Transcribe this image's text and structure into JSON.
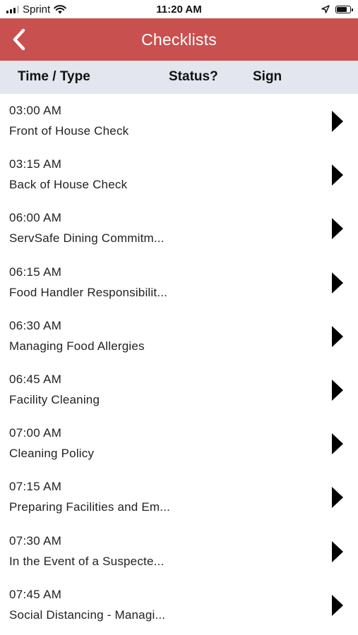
{
  "status_bar": {
    "carrier": "Sprint",
    "time": "11:20 AM",
    "battery_level": 0.8
  },
  "header": {
    "title": "Checklists",
    "back_icon": "chevron-left-icon"
  },
  "columns": {
    "time_type": "Time / Type",
    "status": "Status?",
    "sign": "Sign"
  },
  "colors": {
    "header_bg": "#c8504e",
    "column_header_bg": "#e3e6ee"
  },
  "items": [
    {
      "time": "03:00 AM",
      "title": "Front of House Check"
    },
    {
      "time": "03:15 AM",
      "title": "Back of House Check"
    },
    {
      "time": "06:00 AM",
      "title": "ServSafe Dining Commitm..."
    },
    {
      "time": "06:15 AM",
      "title": "Food Handler Responsibilit..."
    },
    {
      "time": "06:30 AM",
      "title": "Managing Food Allergies"
    },
    {
      "time": "06:45 AM",
      "title": "Facility Cleaning"
    },
    {
      "time": "07:00 AM",
      "title": "Cleaning Policy"
    },
    {
      "time": "07:15 AM",
      "title": "Preparing Facilities and Em..."
    },
    {
      "time": "07:30 AM",
      "title": "In the Event of a Suspecte..."
    },
    {
      "time": "07:45 AM",
      "title": "Social Distancing - Managi..."
    }
  ]
}
